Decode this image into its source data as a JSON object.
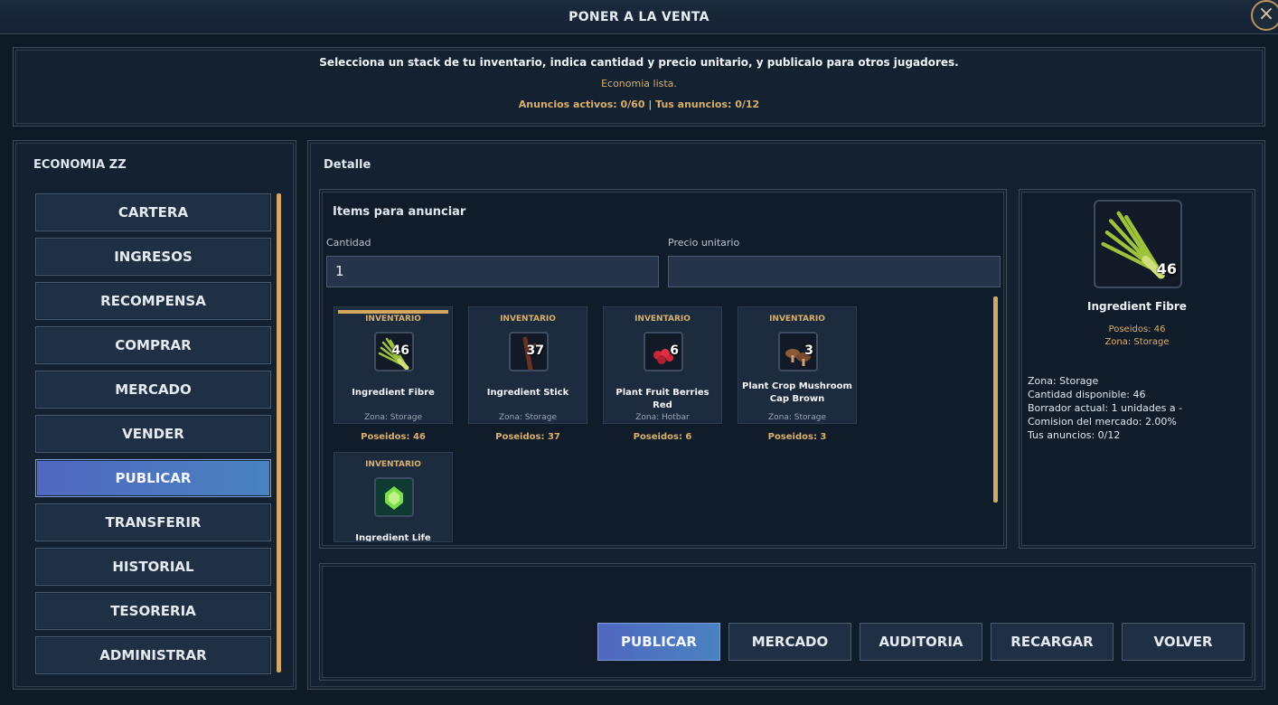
{
  "window": {
    "title": "PONER A LA VENTA",
    "close_symbol": "×"
  },
  "info": {
    "instruction": "Selecciona un stack de tu inventario, indica cantidad y precio unitario, y publicalo para otros jugadores.",
    "status": "Economia lista.",
    "counts": "Anuncios activos: 0/60 | Tus anuncios: 0/12"
  },
  "sidebar": {
    "title": "ECONOMIA ZZ",
    "items": [
      {
        "label": "CARTERA"
      },
      {
        "label": "INGRESOS"
      },
      {
        "label": "RECOMPENSA"
      },
      {
        "label": "COMPRAR"
      },
      {
        "label": "MERCADO"
      },
      {
        "label": "VENDER"
      },
      {
        "label": "PUBLICAR"
      },
      {
        "label": "TRANSFERIR"
      },
      {
        "label": "HISTORIAL"
      },
      {
        "label": "TESORERIA"
      },
      {
        "label": "ADMINISTRAR"
      }
    ],
    "active_index": 6
  },
  "detail": {
    "title": "Detalle",
    "items_title": "Items para anunciar",
    "quantity_label": "Cantidad",
    "quantity_value": "1",
    "price_label": "Precio unitario",
    "price_value": "",
    "items": [
      {
        "tag": "INVENTARIO",
        "count": "46",
        "name": "Ingredient Fibre",
        "zone": "Zona: Storage",
        "owned": "Poseidos: 46",
        "icon": "fibre-icon",
        "selected": true
      },
      {
        "tag": "INVENTARIO",
        "count": "37",
        "name": "Ingredient Stick",
        "zone": "Zona: Storage",
        "owned": "Poseidos: 37",
        "icon": "stick-icon",
        "selected": false
      },
      {
        "tag": "INVENTARIO",
        "count": "6",
        "name": "Plant Fruit Berries Red",
        "zone": "Zona: Hotbar",
        "owned": "Poseidos: 6",
        "icon": "berries-icon",
        "selected": false
      },
      {
        "tag": "INVENTARIO",
        "count": "3",
        "name": "Plant Crop Mushroom Cap Brown",
        "zone": "Zona: Storage",
        "owned": "Poseidos: 3",
        "icon": "mushroom-icon",
        "selected": false
      },
      {
        "tag": "INVENTARIO",
        "count": "",
        "name": "Ingredient Life Essence",
        "zone": "",
        "owned": "",
        "icon": "life-essence-icon",
        "selected": false
      }
    ]
  },
  "preview": {
    "count": "46",
    "name": "Ingredient Fibre",
    "owned": "Poseidos: 46",
    "zone": "Zona: Storage",
    "lines": [
      "Zona: Storage",
      "Cantidad disponible: 46",
      "Borrador actual: 1 unidades a -",
      "Comision del mercado: 2.00%",
      "Tus anuncios: 0/12"
    ]
  },
  "actions": {
    "publish": "PUBLICAR",
    "market": "MERCADO",
    "audit": "AUDITORIA",
    "reload": "RECARGAR",
    "back": "VOLVER"
  },
  "colors": {
    "accent_gold": "#d2a862",
    "active_button": "#4a82c0",
    "panel": "#142131"
  }
}
